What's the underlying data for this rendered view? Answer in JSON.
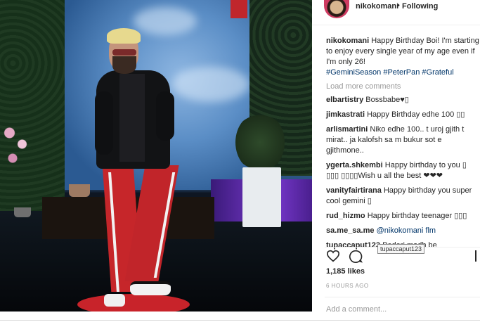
{
  "post": {
    "username": "nikokomani",
    "follow_sep": "•",
    "follow_status": "Following"
  },
  "caption": {
    "username": "nikokomani",
    "text": "Happy Birthday Boi! I'm starting to enjoy every single year of my age even if I'm only 26!",
    "tags": [
      "#GeminiSeason",
      "#PeterPan",
      "#Grateful"
    ]
  },
  "load_more": "Load more comments",
  "comments": [
    {
      "user": "elbartistry",
      "text": "Bossbabe♥▯"
    },
    {
      "user": "jimkastrati",
      "text": "Happy Birthday edhe 100 ▯▯"
    },
    {
      "user": "arlismartini",
      "text": "Niko edhe 100.. t uroj gjith t mirat.. ja kalofsh sa m bukur sot e gjithmone.."
    },
    {
      "user": "ygerta.shkembi",
      "text": "Happy birthday to you ▯ ▯▯▯ ▯▯▯▯Wish u all the best ❤❤❤"
    },
    {
      "user": "vanityfairtirana",
      "text": "Happy birthday you super cool gemini ▯"
    },
    {
      "user": "rud_hizmo",
      "text": "Happy birthday teenager ▯▯▯"
    },
    {
      "user": "sa.me_sa.me",
      "text": "@nikokomani flm"
    },
    {
      "user": "tupaccaput123",
      "text": "Pederi madh be"
    }
  ],
  "tooltip": "tupaccaput123",
  "actions": {
    "like_icon": "heart-icon",
    "comment_icon": "comment-icon"
  },
  "likes": "1,185 likes",
  "time": "6 HOURS AGO",
  "add_comment": {
    "placeholder": "Add a comment..."
  }
}
